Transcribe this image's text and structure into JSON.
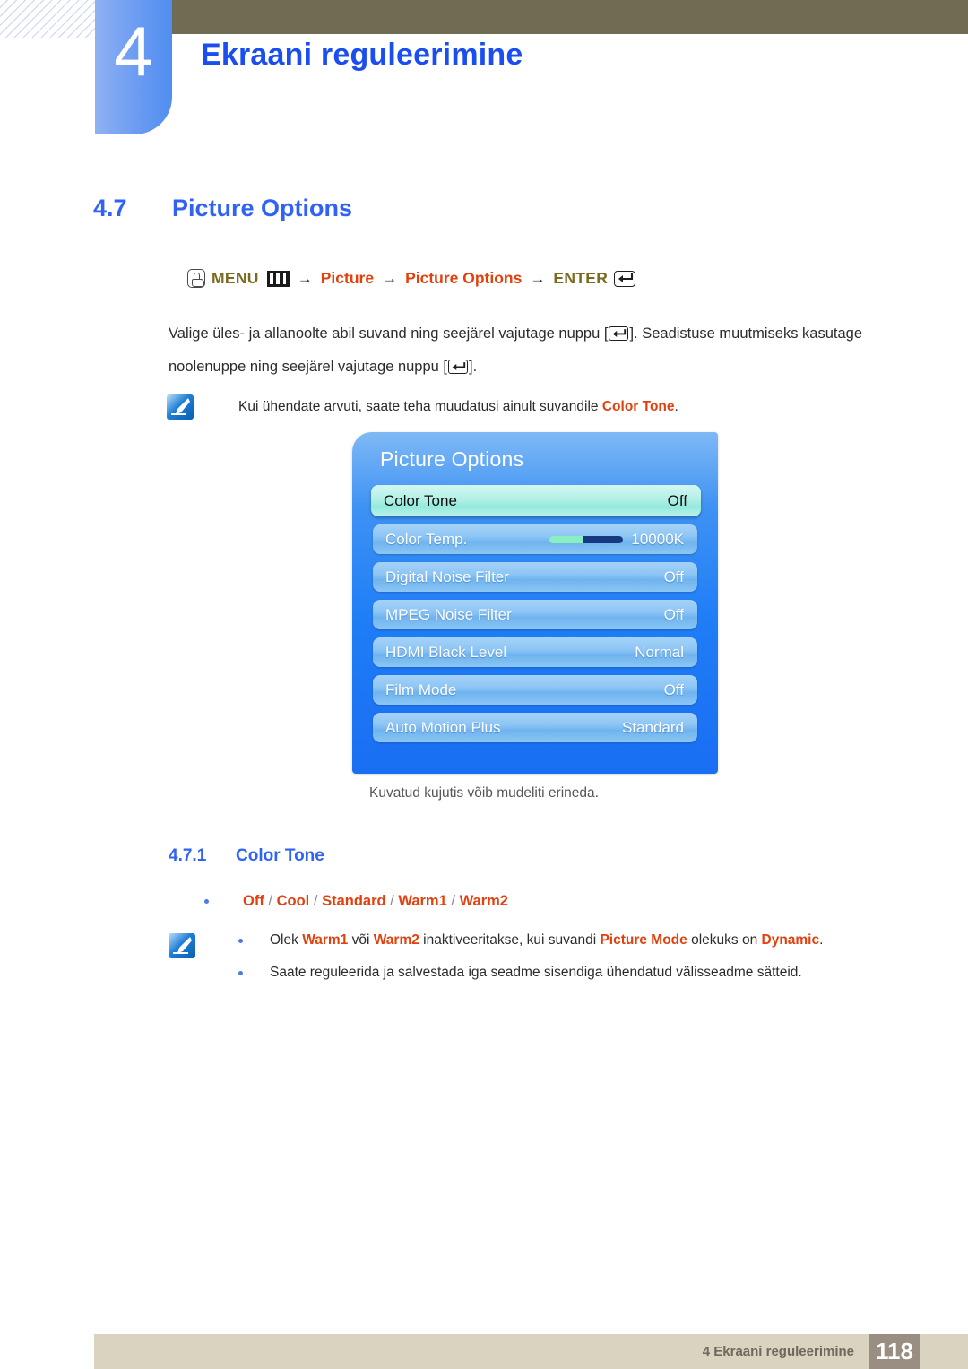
{
  "header": {
    "chapter_number": "4",
    "chapter_title": "Ekraani reguleerimine"
  },
  "section": {
    "number": "4.7",
    "title": "Picture Options"
  },
  "menu_path": {
    "hand_icon": "hand-press-icon",
    "menu_label": "MENU",
    "menu_bars_icon": "menu-bars-icon",
    "arrow1": "→",
    "item1": "Picture",
    "arrow2": "→",
    "item2": "Picture Options",
    "arrow3": "→",
    "enter_label": "ENTER",
    "enter_icon": "enter-key-icon"
  },
  "paragraph": {
    "part1": "Valige üles- ja allanoolte abil suvand ning seejärel vajutage nuppu [",
    "part2": "]. Seadistuse muutmiseks kasutage noolenuppe ning seejärel vajutage nuppu [",
    "part3": "]."
  },
  "note_top": {
    "icon": "note-pen-icon",
    "text_before": "Kui ühendate arvuti, saate teha muudatusi ainult suvandile ",
    "keyword": "Color Tone",
    "text_after": "."
  },
  "osd": {
    "title": "Picture Options",
    "rows": [
      {
        "label": "Color Tone",
        "value": "Off",
        "selected": true,
        "slider": false
      },
      {
        "label": "Color Temp.",
        "value": "10000K",
        "selected": false,
        "slider": true
      },
      {
        "label": "Digital Noise Filter",
        "value": "Off",
        "selected": false,
        "slider": false
      },
      {
        "label": "MPEG Noise Filter",
        "value": "Off",
        "selected": false,
        "slider": false
      },
      {
        "label": "HDMI Black Level",
        "value": "Normal",
        "selected": false,
        "slider": false
      },
      {
        "label": "Film Mode",
        "value": "Off",
        "selected": false,
        "slider": false
      },
      {
        "label": "Auto Motion Plus",
        "value": "Standard",
        "selected": false,
        "slider": false
      }
    ],
    "slider_fill_percent": 45,
    "caption": "Kuvatud kujutis võib mudeliti erineda.",
    "colors": {
      "panel_top": "#7fb9f5",
      "panel_bottom": "#1a6ef2",
      "row_bg": "#8ec6f5",
      "selected_row_bg": "#b2f0e6",
      "slider_fill": "#89efc0",
      "slider_track": "#17397f"
    }
  },
  "subsection": {
    "number": "4.7.1",
    "title": "Color Tone"
  },
  "options": {
    "bullet": "•",
    "items": [
      "Off",
      "Cool",
      "Standard",
      "Warm1",
      "Warm2"
    ],
    "separator": "/"
  },
  "note_bottom": {
    "icon": "note-pen-icon",
    "items": [
      {
        "seg1": "Olek ",
        "kw1": "Warm1",
        "seg2": " või ",
        "kw2": "Warm2",
        "seg3": " inaktiveeritakse, kui suvandi ",
        "kw3": "Picture Mode",
        "seg4": " olekuks on ",
        "kw4": "Dynamic",
        "seg5": "."
      },
      {
        "seg1": "Saate reguleerida ja salvestada iga seadme sisendiga ühendatud välisseadme sätteid.",
        "kw1": "",
        "seg2": "",
        "kw2": "",
        "seg3": "",
        "kw3": "",
        "seg4": "",
        "kw4": "",
        "seg5": ""
      }
    ]
  },
  "footer": {
    "text": "4 Ekraani reguleerimine",
    "page_number": "118"
  }
}
